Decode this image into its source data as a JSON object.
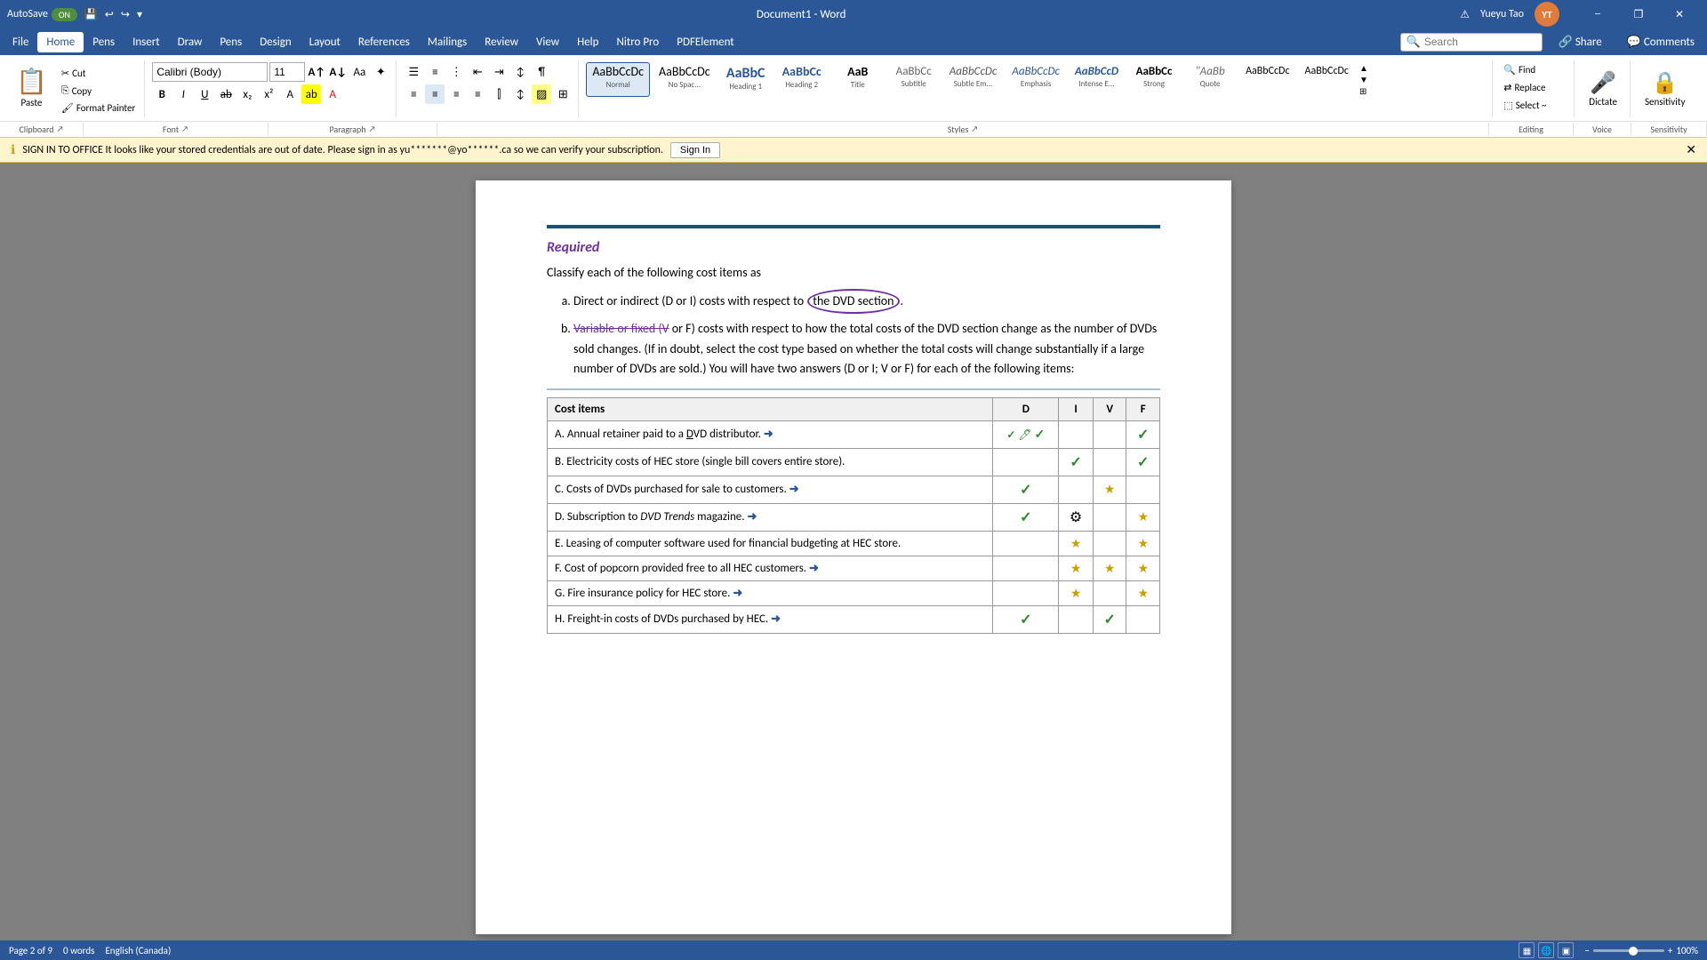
{
  "titlebar": {
    "autosave": "AutoSave",
    "toggle": "ON",
    "doc_title": "Document1 - Word",
    "username": "Yueyu Tao",
    "user_initials": "YT"
  },
  "menu": {
    "items": [
      "File",
      "Home",
      "Pens",
      "Insert",
      "Draw",
      "Pens",
      "Design",
      "Layout",
      "References",
      "Mailings",
      "Review",
      "View",
      "Help",
      "Nitro Pro",
      "PDFElement"
    ]
  },
  "ribbon": {
    "clipboard": {
      "label": "Clipboard",
      "paste": "Paste",
      "cut": "Cut",
      "copy": "Copy",
      "format_painter": "Format Painter"
    },
    "font": {
      "label": "Font",
      "name": "Calibri (Body)",
      "size": "11",
      "bold": "B",
      "italic": "I",
      "underline": "U"
    },
    "paragraph": {
      "label": "Paragraph"
    },
    "styles": {
      "label": "Styles",
      "items": [
        "Normal",
        "No Spac...",
        "Heading 1",
        "Heading 2",
        "Title",
        "Subtitle",
        "Subtle Em...",
        "Emphasis",
        "Intense E...",
        "Strong",
        "Quote",
        "AaBbCcDc",
        "AaBbCcDc",
        "AaBbCcDc"
      ]
    },
    "editing": {
      "label": "Editing",
      "find": "Find",
      "replace": "Replace",
      "select": "Select ~"
    },
    "voice": {
      "label": "Voice",
      "dictate": "Dictate"
    },
    "sensitivity": {
      "label": "Sensitivity",
      "value": "Sensitivity"
    },
    "search": {
      "placeholder": "Search"
    }
  },
  "notification": {
    "icon": "ℹ",
    "message": "SIGN IN TO OFFICE   It looks like your stored credentials are out of date. Please sign in as yu*******@yo******.ca so we can verify your subscription.",
    "button": "Sign In"
  },
  "document": {
    "required_label": "Required",
    "classify_text": "Classify each of the following cost items as",
    "list_items": [
      {
        "label": "a.",
        "text": "Direct or indirect (D or I) costs with respect to the DVD section."
      },
      {
        "label": "b.",
        "text": "Variable or fixed (V or F) costs with respect to how the total costs of the DVD section change as the number of DVDs sold changes. (If in doubt, select the cost type based on whether the total costs will change substantially if a large number of DVDs are sold.) You will have two answers (D or I; V or F) for each of the following items:"
      }
    ],
    "table": {
      "header": [
        "Cost items",
        "D",
        "I",
        "V",
        "F"
      ],
      "rows": [
        {
          "item": "A. Annual retainer paid to a DVD distributor.",
          "arrow": "→",
          "D": "✓✓✓",
          "I": "",
          "V": "",
          "F": "✓"
        },
        {
          "item": "B. Electricity costs of HEC store (single bill covers entire store).",
          "arrow": "",
          "D": "",
          "I": "✓",
          "V": "",
          "F": "✓"
        },
        {
          "item": "C. Costs of DVDs purchased for sale to customers.",
          "arrow": "→",
          "D": "✓",
          "I": "",
          "V": "★",
          "F": ""
        },
        {
          "item": "D. Subscription to DVD Trends magazine.",
          "arrow": "→",
          "D": "✓",
          "I": "⚙",
          "V": "",
          "F": "★"
        },
        {
          "item": "E. Leasing of computer software used for financial budgeting at HEC store.",
          "arrow": "",
          "D": "",
          "I": "★",
          "V": "",
          "F": "★"
        },
        {
          "item": "F. Cost of popcorn provided free to all HEC customers.",
          "arrow": "→",
          "D": "",
          "I": "★",
          "V": "★",
          "F": "★"
        },
        {
          "item": "G. Fire insurance policy for HEC store.",
          "arrow": "→",
          "D": "",
          "I": "★",
          "V": "",
          "F": "★"
        },
        {
          "item": "H. Freight-in costs of DVDs purchased by HEC.",
          "arrow": "→",
          "D": "✓",
          "I": "",
          "V": "✓",
          "F": ""
        }
      ]
    }
  },
  "statusbar": {
    "page": "Page 2 of 9",
    "words": "0 words",
    "language": "English (Canada)",
    "zoom": "100%"
  },
  "colors": {
    "accent": "#2b5797",
    "green_check": "#2d8a2d",
    "star_color": "#c8a000",
    "purple": "#7030a0"
  }
}
